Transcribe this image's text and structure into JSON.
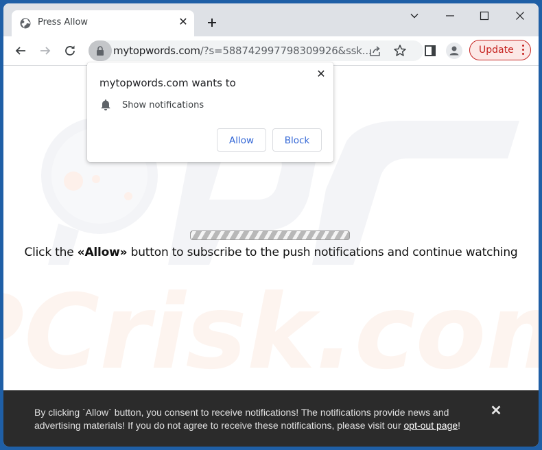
{
  "browser": {
    "tab": {
      "title": "Press Allow",
      "icon": "globe-icon"
    },
    "new_tab_icon": "plus-icon",
    "window_controls": [
      "chevron-down-icon",
      "minimize-icon",
      "maximize-icon",
      "close-icon"
    ],
    "url": {
      "domain": "mytopwords.com",
      "path": "/?s=588742997798309926&ssk..."
    },
    "update_button": {
      "label": "Update"
    }
  },
  "permission_popup": {
    "title": "mytopwords.com wants to",
    "permission": "Show notifications",
    "allow_label": "Allow",
    "block_label": "Block"
  },
  "page": {
    "progress": {
      "state": "indeterminate"
    },
    "message": {
      "prefix": "Click the ",
      "highlight": "«Allow»",
      "suffix": " button to subscribe to the push notifications and continue watching"
    },
    "watermark": "PCrisk.com"
  },
  "banner": {
    "text_before": "By clicking `Allow` button, you consent to receive notifications! The notifications provide news and advertising materials! If you do not agree to receive these notifications, please visit our ",
    "link_label": "opt-out page",
    "text_after": "!"
  },
  "colors": {
    "frame": "#1f5fa6",
    "update_accent": "#c5221f",
    "button_text": "#3367d6",
    "banner_bg": "#2b2b2b"
  }
}
